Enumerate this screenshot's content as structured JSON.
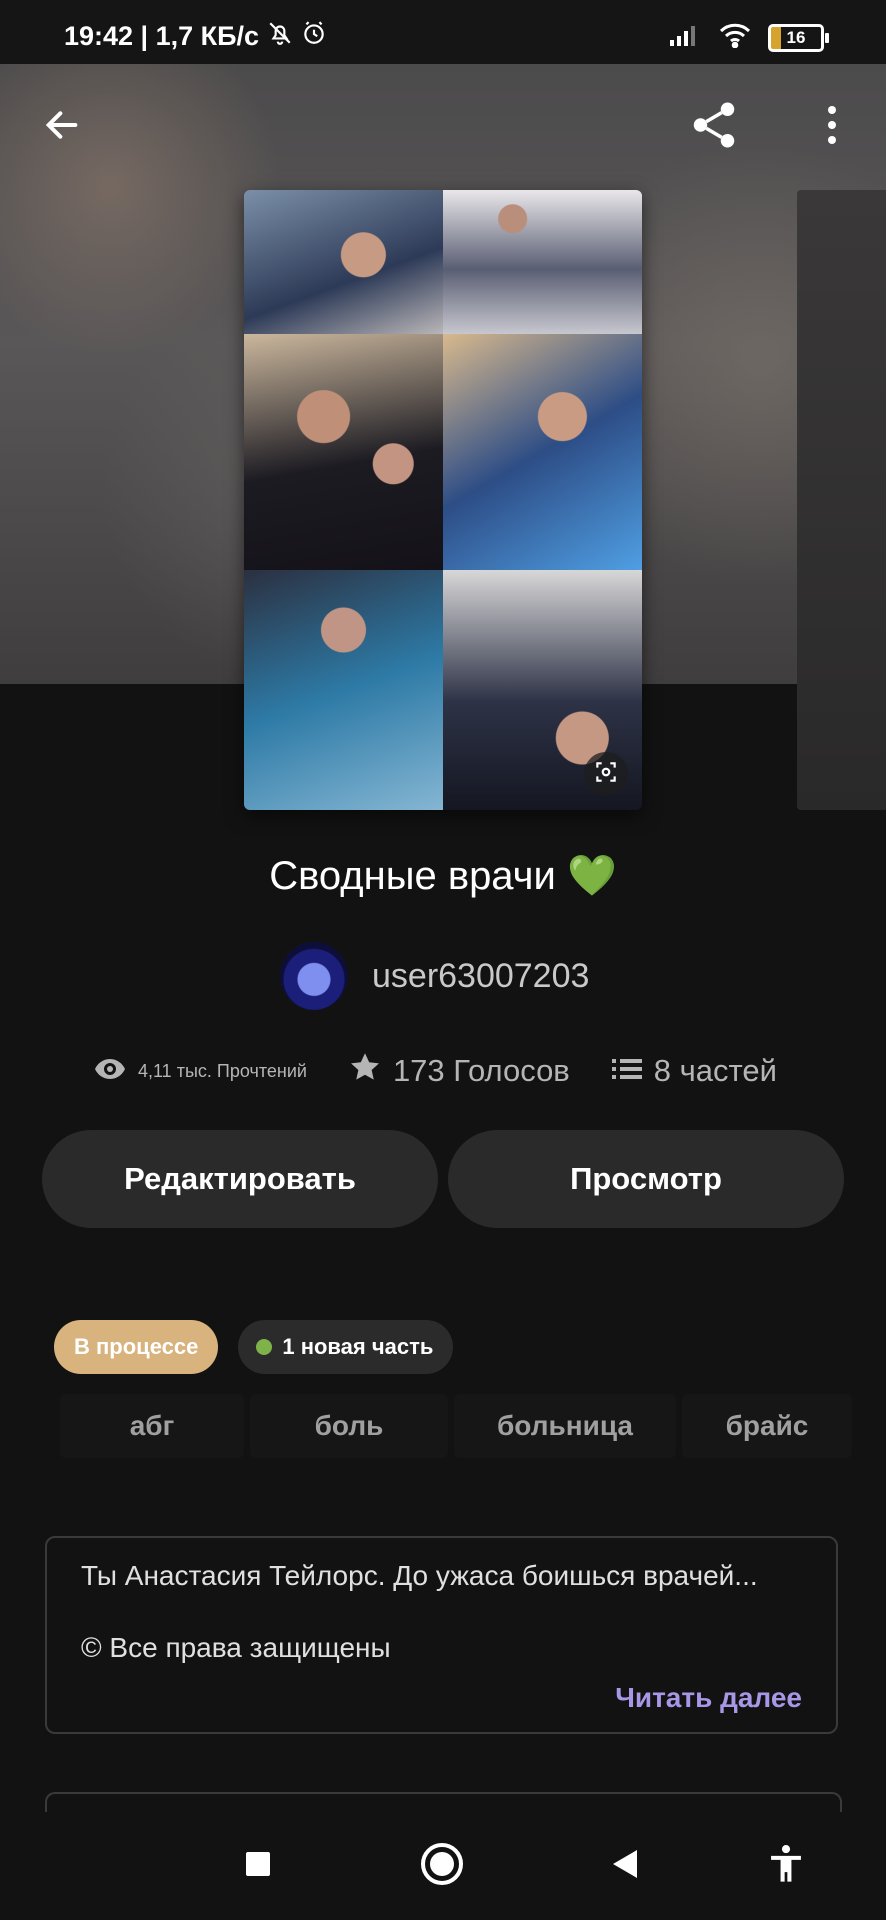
{
  "status_bar": {
    "time_speed": "19:42 | 1,7 КБ/с",
    "battery": "16"
  },
  "toolbar": {
    "back_icon": "arrow-left-icon",
    "share_icon": "share-icon",
    "more_icon": "more-vert-icon"
  },
  "story": {
    "title": "Сводные врачи 💚",
    "author": "user63007203",
    "stats": {
      "reads": "4,11 тыс. Прочтений",
      "votes": "173 Голосов",
      "parts": "8 частей"
    }
  },
  "actions": {
    "edit_label": "Редактировать",
    "view_label": "Просмотр"
  },
  "badges": {
    "status": "В процессе",
    "new_part": "1 новая часть"
  },
  "tags": [
    "абг",
    "боль",
    "больница",
    "брайс"
  ],
  "description": {
    "text": "Ты Анастасия Тейлорс. До ужаса боишься врачей...",
    "copyright": "© Все права защищены",
    "read_more": "Читать далее"
  },
  "colors": {
    "background": "#121212",
    "status_badge": "#d8b37d",
    "new_part_dot": "#7fb24a",
    "read_more": "#a897e6"
  }
}
